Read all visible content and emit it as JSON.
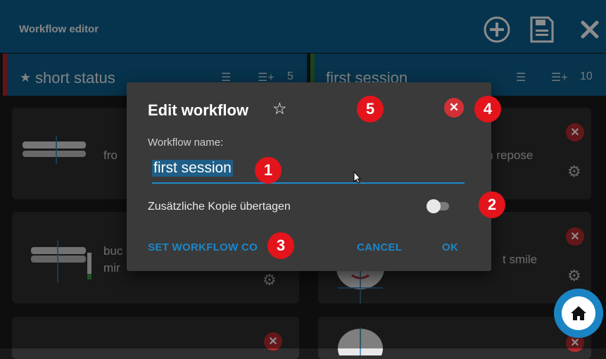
{
  "appbar": {
    "title": "Workflow editor",
    "icons": [
      "add-circle-icon",
      "save-icon",
      "close-icon"
    ]
  },
  "columns": [
    {
      "name": "short status",
      "starred": true,
      "accent": "#b3262c",
      "count": "5"
    },
    {
      "name": "first session",
      "starred": false,
      "accent": "#2e7d32",
      "count": "10"
    }
  ],
  "cards": {
    "left": [
      {
        "label": "fro"
      },
      {
        "label": "buc",
        "label2": "mir"
      },
      {
        "label": ""
      }
    ],
    "right": [
      {
        "label": "t in repose"
      },
      {
        "label": "t smile"
      },
      {
        "label": ""
      }
    ]
  },
  "dialog": {
    "title": "Edit workflow",
    "star": "☆",
    "field_label": "Workflow name:",
    "field_value": "first session",
    "toggle_label": "Zusätzliche Kopie übertagen",
    "toggle_on": false,
    "set_button": "SET WORKFLOW CO",
    "cancel_button": "CANCEL",
    "ok_button": "OK"
  },
  "markers": [
    "1",
    "2",
    "3",
    "4",
    "5"
  ],
  "colors": {
    "accent": "#1d86c9",
    "bar": "#0c5f8e",
    "danger": "#d23036"
  }
}
